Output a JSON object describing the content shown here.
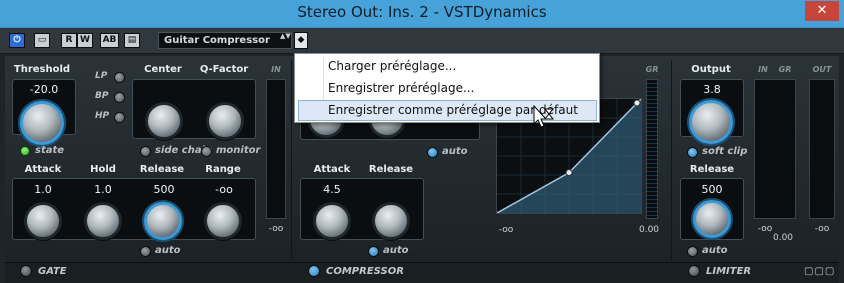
{
  "window": {
    "title": "Stereo Out: Ins. 2 - VSTDynamics",
    "close_label": "✕"
  },
  "toolbar": {
    "power_label": "⏻",
    "bypass_label": "▭",
    "r_label": "R",
    "w_label": "W",
    "ab_label": "AB",
    "compare_label": "▤",
    "preset_name": "Guitar Compressor",
    "preset_stepper": "▲▼",
    "preset_menu_label": "◆",
    "right_dropdown_label": "▼"
  },
  "gate": {
    "threshold_label": "Threshold",
    "threshold_value": "-20.0",
    "state_label": "state",
    "filter_lp": "LP",
    "filter_bp": "BP",
    "filter_hp": "HP",
    "center_label": "Center",
    "qfactor_label": "Q-Factor",
    "side_chain_label": "side chain",
    "monitor_label": "monitor",
    "attack_label": "Attack",
    "attack_value": "1.0",
    "hold_label": "Hold",
    "hold_value": "1.0",
    "release_label": "Release",
    "release_value": "500",
    "range_label": "Range",
    "range_value": "-oo",
    "auto_label": "auto",
    "in_meter_label": "IN",
    "in_meter_value": "-oo",
    "footer_label": "GATE"
  },
  "compressor": {
    "auto_label": "auto",
    "attack_label": "Attack",
    "attack_value": "4.5",
    "release_label": "Release",
    "release_value": "",
    "release_auto_label": "auto",
    "gr_label": "GR",
    "graph_left_label": "-oo",
    "graph_right_label": "0.00",
    "footer_label": "COMPRESSOR"
  },
  "limiter": {
    "output_label": "Output",
    "output_value": "3.8",
    "soft_clip_label": "soft clip",
    "release_label": "Release",
    "release_value": "500",
    "auto_label": "auto",
    "in_label": "IN",
    "gr_label": "GR",
    "out_label": "OUT",
    "meter_in_value": "-oo",
    "meter_gr_value": "0.00",
    "meter_out_value": "-oo",
    "footer_label": "LIMITER",
    "footer_icons": "▢▢▢"
  },
  "context_menu": {
    "items": [
      "Charger préréglage...",
      "Enregistrer préréglage...",
      "Enregistrer comme préréglage par défaut"
    ],
    "highlighted_index": 2
  },
  "curve": {
    "input_db": [
      -96,
      -48,
      0
    ],
    "output_db": [
      -96,
      -62,
      0
    ],
    "points_db": [
      {
        "in": -48,
        "out": -62
      },
      {
        "in": 0,
        "out": 0
      }
    ]
  }
}
